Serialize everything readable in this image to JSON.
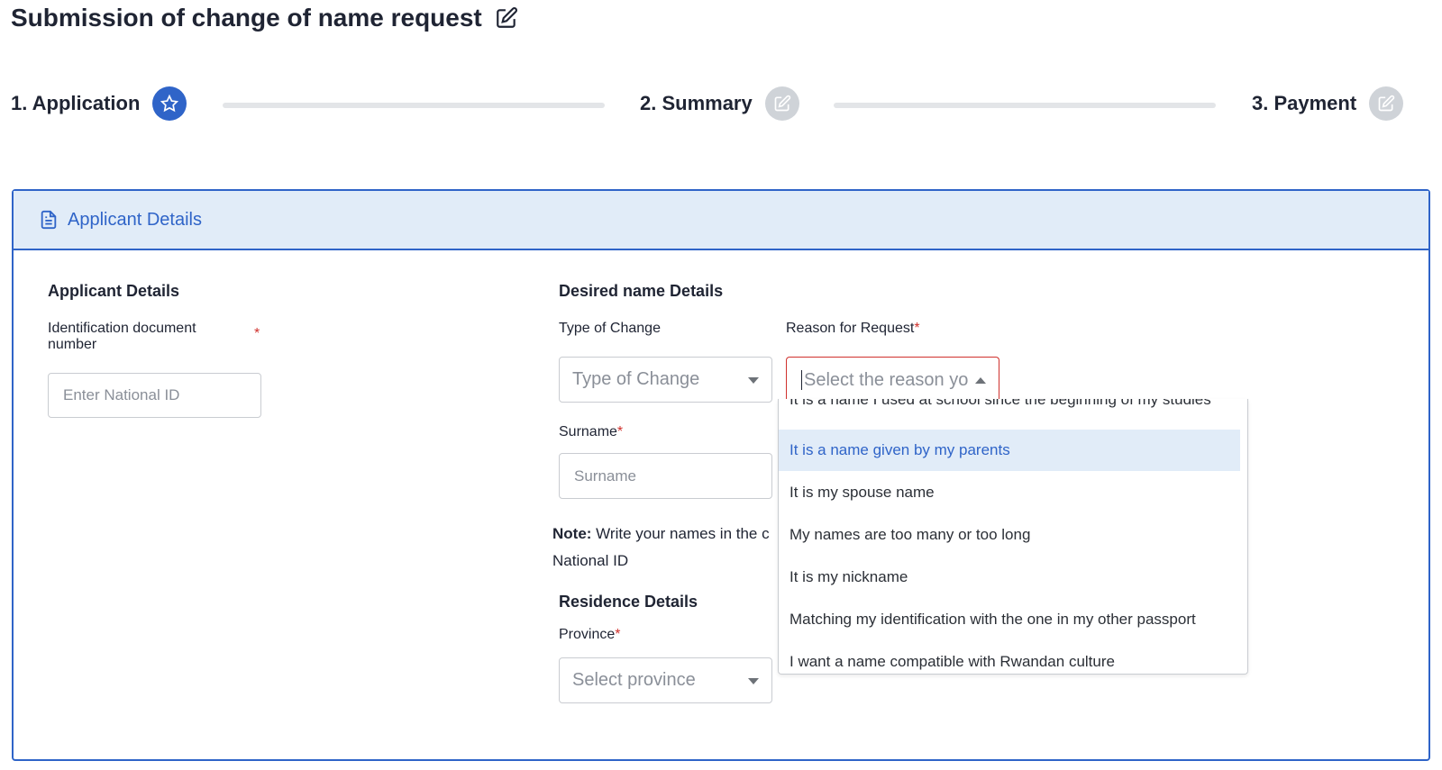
{
  "page": {
    "title": "Submission of change of name request"
  },
  "steps": [
    {
      "label": "1. Application",
      "icon": "star-icon",
      "state": "active"
    },
    {
      "label": "2. Summary",
      "icon": "edit-icon",
      "state": "inactive"
    },
    {
      "label": "3. Payment",
      "icon": "edit-icon",
      "state": "inactive"
    }
  ],
  "card": {
    "header": "Applicant Details",
    "header_icon": "document-icon"
  },
  "applicant": {
    "section_title": "Applicant Details",
    "id_label": "Identification document number",
    "required_mark": "*",
    "id_placeholder": "Enter National ID"
  },
  "desired": {
    "section_title": "Desired name Details",
    "type_label": "Type of Change",
    "type_placeholder": "Type of Change",
    "reason_label": "Reason for Request",
    "reason_placeholder": "Select the reason yo",
    "surname_label": "Surname",
    "surname_placeholder": "Surname",
    "note_prefix": "Note:",
    "note_text": " Write your names in the c",
    "note_line2": "National ID"
  },
  "residence": {
    "section_title": "Residence Details",
    "province_label": "Province",
    "province_placeholder": "Select province"
  },
  "reason_options": [
    "It is a name I used at school since the beginning of my studies",
    "It is a name given by my parents",
    "It is my spouse name",
    "My names are too many or too long",
    "It is my nickname",
    "Matching my identification with the one in my other passport",
    "I want a name compatible with Rwandan culture"
  ],
  "selected_option_index": 1,
  "colors": {
    "accent": "#2f64c8",
    "required": "#d0312d",
    "highlight": "#e1ecf8"
  }
}
